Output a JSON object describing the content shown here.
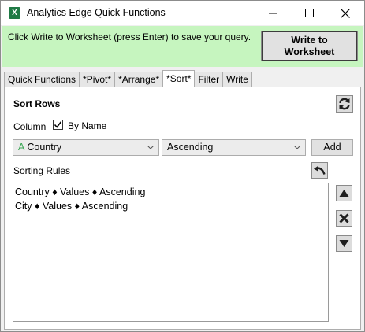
{
  "window": {
    "title": "Analytics Edge Quick Functions",
    "app_icon_letter": "X",
    "controls": [
      "minimize-icon",
      "maximize-icon",
      "close-icon"
    ]
  },
  "banner": {
    "message": "Click Write to Worksheet (press Enter) to save your query.",
    "write_button": "Write to\nWorksheet",
    "background": "#c6f5bf"
  },
  "tabs": [
    {
      "label": "Quick Functions",
      "active": false
    },
    {
      "label": "*Pivot*",
      "active": false
    },
    {
      "label": "*Arrange*",
      "active": false
    },
    {
      "label": "*Sort*",
      "active": true
    },
    {
      "label": "Filter",
      "active": false
    },
    {
      "label": "Write",
      "active": false
    }
  ],
  "sort": {
    "section_title": "Sort Rows",
    "column_label": "Column",
    "by_name_label": "By Name",
    "by_name_checked": true,
    "column_type_icon": "A",
    "column_value": "Country",
    "order_value": "Ascending",
    "add_button": "Add",
    "rules_label": "Sorting Rules",
    "rules": [
      "Country ♦ Values ♦ Ascending",
      "City ♦ Values ♦ Ascending"
    ]
  },
  "icons": {
    "refresh": "refresh-icon",
    "undo": "undo-icon",
    "move_up": "move-up-icon",
    "delete": "delete-icon",
    "move_down": "move-down-icon"
  }
}
